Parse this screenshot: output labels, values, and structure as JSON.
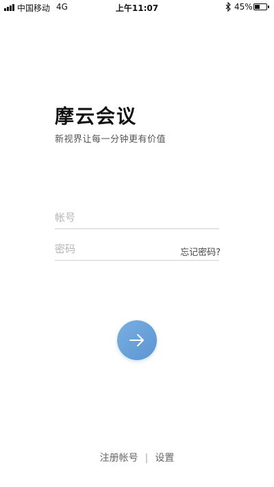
{
  "status_bar": {
    "carrier": "中国移动",
    "network": "4G",
    "time": "上午11:07",
    "battery_percent": "45%",
    "battery_level": 0.45,
    "signal_icon": "signal-bars-icon",
    "bluetooth_icon": "bluetooth-icon",
    "battery_icon": "battery-icon"
  },
  "app": {
    "title": "摩云会议",
    "subtitle": "新视界让每一分钟更有价值"
  },
  "form": {
    "username_placeholder": "帐号",
    "password_placeholder": "密码",
    "forgot_password": "忘记密码?"
  },
  "submit": {
    "icon": "arrow-right-icon",
    "color_start": "#79aee0",
    "color_end": "#5b95d3"
  },
  "footer": {
    "register": "注册帐号",
    "separator": "|",
    "settings": "设置"
  }
}
